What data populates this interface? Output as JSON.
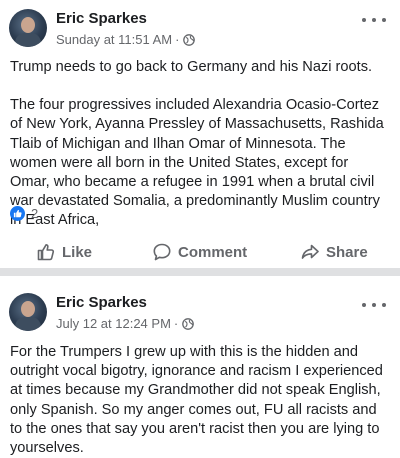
{
  "posts": [
    {
      "author": "Eric Sparkes",
      "timestamp": "Sunday at 11:51 AM",
      "separator": "·",
      "paragraphs": [
        "Trump needs to go back to Germany and his Nazi roots.",
        "The four progressives included Alexandria Ocasio-Cortez of New York, Ayanna Pressley of Massachusetts, Rashida Tlaib of Michigan and Ilhan Omar of Minnesota. The women were all born in the United States, except for Omar, who became a refugee in 1991 when a brutal civil war devastated Somalia, a predominantly Muslim country in East Africa,"
      ],
      "reaction_count": "2",
      "actions": {
        "like": "Like",
        "comment": "Comment",
        "share": "Share"
      }
    },
    {
      "author": "Eric Sparkes",
      "timestamp": "July 12 at 12:24 PM",
      "separator": "·",
      "paragraphs": [
        "For the Trumpers I grew up with this is the hidden and outright vocal bigotry, ignorance and racism I experienced at times because my Grandmother did not speak English, only Spanish. So my anger comes out,  FU all racists and to the ones that say you aren't racist then you are lying to yourselves."
      ]
    }
  ],
  "icons": {
    "privacy": "globe-icon",
    "options": "more-options-icon",
    "reaction": "like-reaction-icon",
    "like": "thumbs-up-icon",
    "comment": "comment-bubble-icon",
    "share": "share-arrow-icon"
  },
  "colors": {
    "brand_blue": "#1877f2",
    "secondary_text": "#65676b",
    "divider": "#dfe0e2"
  }
}
